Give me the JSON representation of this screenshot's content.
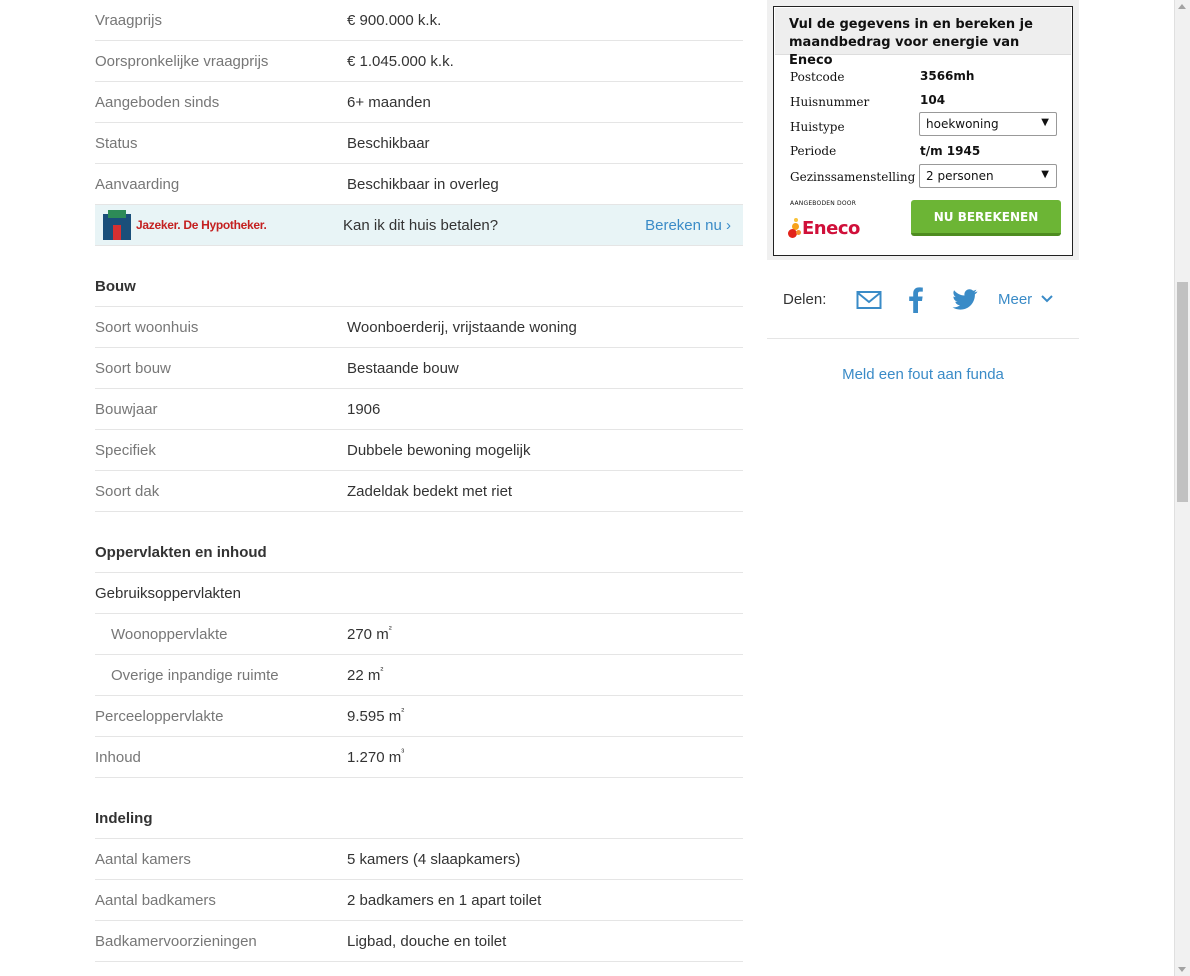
{
  "overdracht": [
    {
      "key": "Vraagprijs",
      "value": "€ 900.000 k.k."
    },
    {
      "key": "Oorspronkelijke vraagprijs",
      "value": "€ 1.045.000 k.k."
    },
    {
      "key": "Aangeboden sinds",
      "value": "6+ maanden"
    },
    {
      "key": "Status",
      "value": "Beschikbaar"
    },
    {
      "key": "Aanvaarding",
      "value": "Beschikbaar in overleg"
    }
  ],
  "promo": {
    "brand": "Jazeker. De Hypotheker.",
    "question": "Kan ik dit huis betalen?",
    "link": "Bereken nu ›"
  },
  "bouw": {
    "title": "Bouw",
    "rows": [
      {
        "key": "Soort woonhuis",
        "value": "Woonboerderij, vrijstaande woning"
      },
      {
        "key": "Soort bouw",
        "value": "Bestaande bouw"
      },
      {
        "key": "Bouwjaar",
        "value": "1906"
      },
      {
        "key": "Specifiek",
        "value": "Dubbele bewoning mogelijk"
      },
      {
        "key": "Soort dak",
        "value": "Zadeldak bedekt met riet"
      }
    ]
  },
  "oppervlakten": {
    "title": "Oppervlakten en inhoud",
    "sub": "Gebruiksoppervlakten",
    "woon": {
      "key": "Woonoppervlakte",
      "value": "270 m",
      "sup": "²"
    },
    "overig": {
      "key": "Overige inpandige ruimte",
      "value": "22 m",
      "sup": "²"
    },
    "perceel": {
      "key": "Perceeloppervlakte",
      "value": "9.595 m",
      "sup": "²"
    },
    "inhoud": {
      "key": "Inhoud",
      "value": "1.270 m",
      "sup": "³"
    }
  },
  "indeling": {
    "title": "Indeling",
    "rows": [
      {
        "key": "Aantal kamers",
        "value": "5 kamers (4 slaapkamers)"
      },
      {
        "key": "Aantal badkamers",
        "value": "2 badkamers en 1 apart toilet"
      },
      {
        "key": "Badkamervoorzieningen",
        "value": "Ligbad, douche en toilet"
      }
    ]
  },
  "eneco": {
    "heading": "Vul de gegevens in en bereken je maandbedrag voor energie van Eneco",
    "postcode_label": "Postcode",
    "postcode": "3566mh",
    "huisnummer_label": "Huisnummer",
    "huisnummer": "104",
    "huistype_label": "Huistype",
    "huistype": "hoekwoning",
    "periode_label": "Periode",
    "periode": "t/m 1945",
    "gezin_label": "Gezinssamenstelling",
    "gezin": "2 personen",
    "aangeboden": "AANGEBODEN DOOR",
    "logo": "Eneco",
    "button": "NU BEREKENEN"
  },
  "share": {
    "label": "Delen:",
    "meer": "Meer"
  },
  "meld": "Meld een fout aan funda",
  "colors": {
    "link": "#3a8bc7",
    "eneco_red": "#d0103a",
    "button_green": "#6cb535"
  }
}
